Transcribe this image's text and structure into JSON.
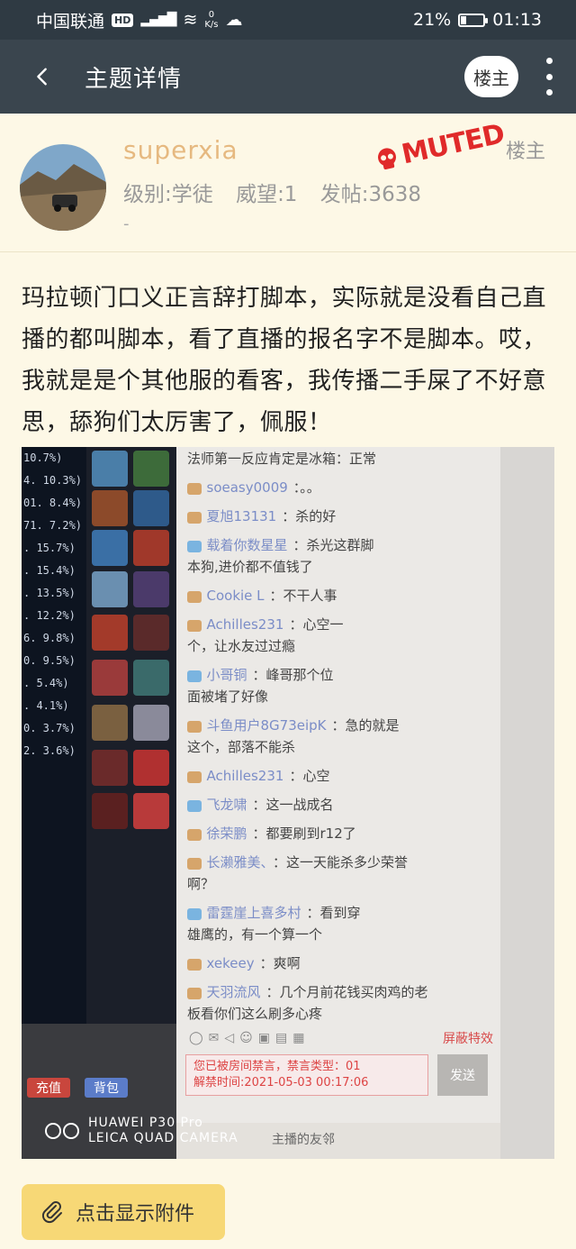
{
  "status_bar": {
    "carrier": "中国联通",
    "hd_badge": "HD",
    "network": "4G",
    "speed_value": "0",
    "speed_unit": "K/s",
    "battery_percent": "21%",
    "battery_level": 0.21,
    "time": "01:13"
  },
  "titlebar": {
    "title": "主题详情",
    "owner_button": "楼主"
  },
  "post": {
    "username": "superxia",
    "level": "级别:学徒",
    "prestige": "威望:1",
    "posts": "发帖:3638",
    "dash": "-",
    "muted_badge": "MUTED",
    "owner_tag": "楼主",
    "text": "玛拉顿门口义正言辞打脚本，实际就是没看自己直播的都叫脚本，看了直播的报名字不是脚本。哎，我就是是个其他服的看客，我传播二手屎了不好意思，舔狗们太厉害了，佩服！"
  },
  "photo": {
    "percent_list": [
      "10.7%)",
      "4. 10.3%)",
      "01. 8.4%)",
      "71. 7.2%)",
      "",
      ". 15.7%)",
      ". 15.4%)",
      ". 13.5%)",
      ". 12.2%)",
      "6. 9.8%)",
      "0. 9.5%)",
      ". 5.4%)",
      ". 4.1%)",
      "0. 3.7%)",
      "2. 3.6%)"
    ],
    "chat": [
      {
        "text": "法师第一反应肯定是冰箱",
        "tail": "：正常"
      },
      {
        "name": "soeasy0009",
        "msg": "：。。"
      },
      {
        "name": "夏旭13131",
        "msg": "：杀的好"
      },
      {
        "name": "载着你数星星",
        "msg": "：杀光这群脚",
        "cont": "本狗,进价都不值钱了"
      },
      {
        "name": "Cookie L",
        "msg": "：不干人事"
      },
      {
        "name": "Achilles231",
        "msg": "：心空一",
        "cont": "个，让水友过过瘾"
      },
      {
        "name": "小哥铜",
        "msg": "：峰哥那个位",
        "cont": "面被堵了好像"
      },
      {
        "name": "斗鱼用户8G73eipK",
        "msg": "：急的就是",
        "cont": "这个，部落不能杀"
      },
      {
        "name": "Achilles231",
        "msg": "：心空"
      },
      {
        "name": "飞龙啸",
        "msg": "：这一战成名"
      },
      {
        "name": "徐荣鹏",
        "msg": "：都要刷到r12了"
      },
      {
        "name": "长濑雅美、",
        "msg": "：这一天能杀多少荣誉",
        "cont": "啊？"
      },
      {
        "name": "雷霆崖上喜多村",
        "msg": "：看到穿",
        "cont": "雄鹰的，有一个算一个"
      },
      {
        "name": "xekeey",
        "msg": "：爽啊"
      },
      {
        "name": "天羽流风",
        "msg": "：几个月前花钱买肉鸡的老",
        "cont": "板看你们这么刷多心疼"
      }
    ],
    "shield_label": "屏蔽特效",
    "mute_line1": "您已被房间禁言，禁言类型：01",
    "mute_line2": "解禁时间:2021-05-03 00:17:06",
    "send_label": "发送",
    "recharge_label": "充值",
    "bag_label": "背包",
    "camera_line1": "HUAWEI P30 Pro",
    "camera_line2": "LEICA QUAD CAMERA",
    "friends_label": "主播的友邻"
  },
  "attachment_button": "点击显示附件",
  "colors": {
    "header_bg": "#3a454e",
    "page_bg": "#fdf8e6",
    "username": "#e6b980",
    "muted_red": "#e02a2a",
    "attach_bg": "#f7d876"
  }
}
